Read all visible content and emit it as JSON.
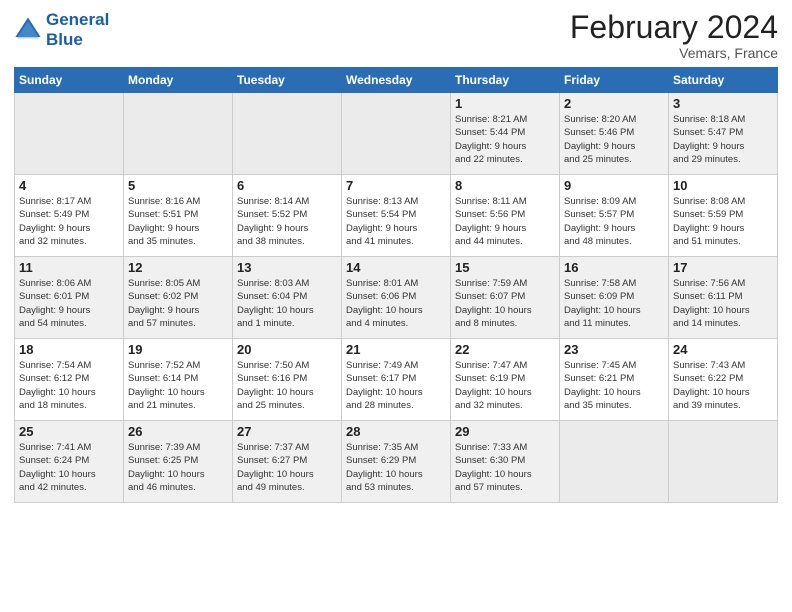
{
  "header": {
    "logo_line1": "General",
    "logo_line2": "Blue",
    "month_title": "February 2024",
    "location": "Vemars, France"
  },
  "weekdays": [
    "Sunday",
    "Monday",
    "Tuesday",
    "Wednesday",
    "Thursday",
    "Friday",
    "Saturday"
  ],
  "weeks": [
    [
      {
        "day": "",
        "info": ""
      },
      {
        "day": "",
        "info": ""
      },
      {
        "day": "",
        "info": ""
      },
      {
        "day": "",
        "info": ""
      },
      {
        "day": "1",
        "info": "Sunrise: 8:21 AM\nSunset: 5:44 PM\nDaylight: 9 hours\nand 22 minutes."
      },
      {
        "day": "2",
        "info": "Sunrise: 8:20 AM\nSunset: 5:46 PM\nDaylight: 9 hours\nand 25 minutes."
      },
      {
        "day": "3",
        "info": "Sunrise: 8:18 AM\nSunset: 5:47 PM\nDaylight: 9 hours\nand 29 minutes."
      }
    ],
    [
      {
        "day": "4",
        "info": "Sunrise: 8:17 AM\nSunset: 5:49 PM\nDaylight: 9 hours\nand 32 minutes."
      },
      {
        "day": "5",
        "info": "Sunrise: 8:16 AM\nSunset: 5:51 PM\nDaylight: 9 hours\nand 35 minutes."
      },
      {
        "day": "6",
        "info": "Sunrise: 8:14 AM\nSunset: 5:52 PM\nDaylight: 9 hours\nand 38 minutes."
      },
      {
        "day": "7",
        "info": "Sunrise: 8:13 AM\nSunset: 5:54 PM\nDaylight: 9 hours\nand 41 minutes."
      },
      {
        "day": "8",
        "info": "Sunrise: 8:11 AM\nSunset: 5:56 PM\nDaylight: 9 hours\nand 44 minutes."
      },
      {
        "day": "9",
        "info": "Sunrise: 8:09 AM\nSunset: 5:57 PM\nDaylight: 9 hours\nand 48 minutes."
      },
      {
        "day": "10",
        "info": "Sunrise: 8:08 AM\nSunset: 5:59 PM\nDaylight: 9 hours\nand 51 minutes."
      }
    ],
    [
      {
        "day": "11",
        "info": "Sunrise: 8:06 AM\nSunset: 6:01 PM\nDaylight: 9 hours\nand 54 minutes."
      },
      {
        "day": "12",
        "info": "Sunrise: 8:05 AM\nSunset: 6:02 PM\nDaylight: 9 hours\nand 57 minutes."
      },
      {
        "day": "13",
        "info": "Sunrise: 8:03 AM\nSunset: 6:04 PM\nDaylight: 10 hours\nand 1 minute."
      },
      {
        "day": "14",
        "info": "Sunrise: 8:01 AM\nSunset: 6:06 PM\nDaylight: 10 hours\nand 4 minutes."
      },
      {
        "day": "15",
        "info": "Sunrise: 7:59 AM\nSunset: 6:07 PM\nDaylight: 10 hours\nand 8 minutes."
      },
      {
        "day": "16",
        "info": "Sunrise: 7:58 AM\nSunset: 6:09 PM\nDaylight: 10 hours\nand 11 minutes."
      },
      {
        "day": "17",
        "info": "Sunrise: 7:56 AM\nSunset: 6:11 PM\nDaylight: 10 hours\nand 14 minutes."
      }
    ],
    [
      {
        "day": "18",
        "info": "Sunrise: 7:54 AM\nSunset: 6:12 PM\nDaylight: 10 hours\nand 18 minutes."
      },
      {
        "day": "19",
        "info": "Sunrise: 7:52 AM\nSunset: 6:14 PM\nDaylight: 10 hours\nand 21 minutes."
      },
      {
        "day": "20",
        "info": "Sunrise: 7:50 AM\nSunset: 6:16 PM\nDaylight: 10 hours\nand 25 minutes."
      },
      {
        "day": "21",
        "info": "Sunrise: 7:49 AM\nSunset: 6:17 PM\nDaylight: 10 hours\nand 28 minutes."
      },
      {
        "day": "22",
        "info": "Sunrise: 7:47 AM\nSunset: 6:19 PM\nDaylight: 10 hours\nand 32 minutes."
      },
      {
        "day": "23",
        "info": "Sunrise: 7:45 AM\nSunset: 6:21 PM\nDaylight: 10 hours\nand 35 minutes."
      },
      {
        "day": "24",
        "info": "Sunrise: 7:43 AM\nSunset: 6:22 PM\nDaylight: 10 hours\nand 39 minutes."
      }
    ],
    [
      {
        "day": "25",
        "info": "Sunrise: 7:41 AM\nSunset: 6:24 PM\nDaylight: 10 hours\nand 42 minutes."
      },
      {
        "day": "26",
        "info": "Sunrise: 7:39 AM\nSunset: 6:25 PM\nDaylight: 10 hours\nand 46 minutes."
      },
      {
        "day": "27",
        "info": "Sunrise: 7:37 AM\nSunset: 6:27 PM\nDaylight: 10 hours\nand 49 minutes."
      },
      {
        "day": "28",
        "info": "Sunrise: 7:35 AM\nSunset: 6:29 PM\nDaylight: 10 hours\nand 53 minutes."
      },
      {
        "day": "29",
        "info": "Sunrise: 7:33 AM\nSunset: 6:30 PM\nDaylight: 10 hours\nand 57 minutes."
      },
      {
        "day": "",
        "info": ""
      },
      {
        "day": "",
        "info": ""
      }
    ]
  ]
}
